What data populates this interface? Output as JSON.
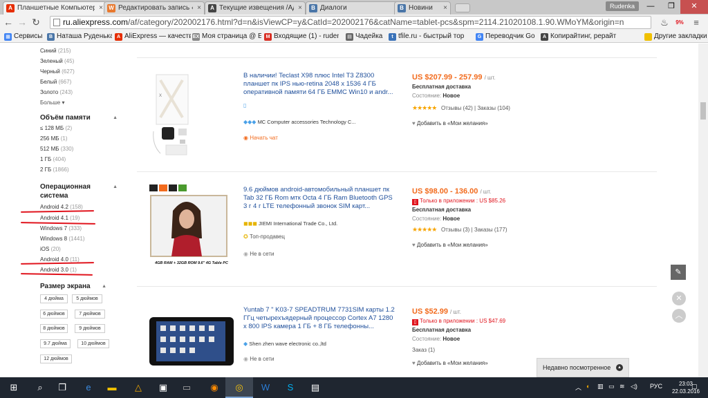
{
  "browser": {
    "tabs": [
      {
        "label": "Планшетные Компьютер",
        "active": true,
        "icon": "aliexpress-icon",
        "color": "#e62e04"
      },
      {
        "label": "Редактировать запись ‹ А",
        "active": false,
        "icon": "wordpress-icon",
        "color": "#e8792f"
      },
      {
        "label": "Текущие извещения /Адм",
        "active": false,
        "icon": "advego-icon",
        "color": "#444444"
      },
      {
        "label": "Диалоги",
        "active": false,
        "icon": "vk-icon",
        "color": "#4a76a8"
      },
      {
        "label": "Новини",
        "active": false,
        "icon": "vk-icon",
        "color": "#4a76a8"
      }
    ],
    "user": "Rudenka",
    "url_host": "ru.aliexpress.com",
    "url_rest": "/af/category/202002176.html?d=n&isViewCP=y&CatId=202002176&catName=tablet-pcs&spm=2114.21020108.1.90.WMoYM&origin=n",
    "ext_badge": "9%"
  },
  "bookmarks": [
    {
      "label": "Сервисы",
      "icon": "apps-icon",
      "color": "#4285f4"
    },
    {
      "label": "Наташа Руденька",
      "icon": "vk-icon",
      "color": "#4a76a8"
    },
    {
      "label": "AliExpress — качеств",
      "icon": "aliexpress-icon",
      "color": "#e62e04"
    },
    {
      "label": "Моя страница @ EXAI",
      "icon": "ex-icon",
      "color": "#888888"
    },
    {
      "label": "Входящие (1) - ruden",
      "icon": "gmail-icon",
      "color": "#d93025"
    },
    {
      "label": "Чадейка",
      "icon": "page-icon",
      "color": "#666666"
    },
    {
      "label": "tfile.ru - быстрый тор",
      "icon": "tfile-icon",
      "color": "#3b73b9"
    },
    {
      "label": "Переводчик Google",
      "icon": "translate-icon",
      "color": "#4285f4"
    },
    {
      "label": "Копирайтинг, рерайт",
      "icon": "advego-icon",
      "color": "#444444"
    },
    {
      "label": "Другие закладки",
      "icon": "folder-icon",
      "color": "#f0c000"
    }
  ],
  "sidebar": {
    "colors": [
      {
        "name": "Синий",
        "count": "(215)"
      },
      {
        "name": "Зеленый",
        "count": "(45)"
      },
      {
        "name": "Черный",
        "count": "(627)"
      },
      {
        "name": "Белый",
        "count": "(667)"
      },
      {
        "name": "Золото",
        "count": "(243)"
      }
    ],
    "more": "Больше ▾",
    "memory_title": "Объём памяти",
    "memory": [
      {
        "name": "≤ 128 МБ",
        "count": "(2)"
      },
      {
        "name": "256 МБ",
        "count": "(1)"
      },
      {
        "name": "512 МБ",
        "count": "(330)"
      },
      {
        "name": "1 ГБ",
        "count": "(404)"
      },
      {
        "name": "2 ГБ",
        "count": "(1866)"
      }
    ],
    "os_title_1": "Операционная",
    "os_title_2": "система",
    "os": [
      {
        "name": "Android 4.2",
        "count": "(158)"
      },
      {
        "name": "Android 4.1",
        "count": "(19)"
      },
      {
        "name": "Windows 7",
        "count": "(333)"
      },
      {
        "name": "Windows 8",
        "count": "(1441)"
      },
      {
        "name": "iOS",
        "count": "(20)"
      },
      {
        "name": "Android 4.0",
        "count": "(11)"
      },
      {
        "name": "Android 3.0",
        "count": "(1)"
      }
    ],
    "screen_title": "Размер экрана",
    "screen_sizes": [
      "4 дюйма",
      "5 дюймов",
      "6 дюймов",
      "7 дюймов",
      "8 дюймов",
      "9 дюймов",
      "9.7 дюйма",
      "10 дюймов",
      "12 дюймов"
    ]
  },
  "products": [
    {
      "title": "В наличии! Teclast X98 плюс Intel T3 Z8300 планшет пк IPS нью-retina 2048 x 1536 4 ГБ оперативной памяти 64 ГБ EMMC Win10 и andr...",
      "store": "MC Computer accessories Technology C...",
      "extra": "Начать чат",
      "price": "US $207.99 - 257.99",
      "unit": "/ шт.",
      "app_price": "",
      "shipping": "Бесплатная доставка",
      "condition_label": "Состояние:",
      "condition": "Новое",
      "reviews": "Отзывы (42)",
      "orders": "Заказы (104)",
      "wishlist": "Добавить в «Мои желания»"
    },
    {
      "title": "9.6 дюймов android-автомобильный планшет пк Tab 32 ГБ Rom мтк Octa 4 ГБ Ram Bluetooth GPS 3 г 4 г LTE телефонный звонок SIM карт...",
      "store": "JIEMI International Trade Co., Ltd.",
      "extra": "Топ-продавец",
      "extra2": "Не в сети",
      "price": "US $98.00 - 136.00",
      "unit": "/ шт.",
      "app_price": "Только в приложении : US $85.26",
      "shipping": "Бесплатная доставка",
      "condition_label": "Состояние:",
      "condition": "Новое",
      "reviews": "Отзывы (3)",
      "orders": "Заказы (177)",
      "wishlist": "Добавить в «Мои желания»",
      "image_caption": "4GB RAM + 32GB ROM 9.6\" 4G Table PC"
    },
    {
      "title": "Yuntab 7 \" K03-7 SPEADTRUM 7731SIM карты 1.2 ГГц четырехъядерный процессор Cortex A7 1280 x 800 IPS камера 1 ГБ + 8 ГБ телефонны...",
      "store": "Shen zhen wave electronic co.,ltd",
      "extra": "Не в сети",
      "price": "US $52.99",
      "unit": "/ шт.",
      "app_price": "Только в приложении : US $47.69",
      "shipping": "Бесплатная доставка",
      "condition_label": "Состояние:",
      "condition": "Новое",
      "orders": "Заказ (1)",
      "wishlist": "Добавить в «Мои желания»"
    }
  ],
  "recently_viewed": "Недавно посмотренное",
  "taskbar": {
    "lang": "РУС",
    "time": "23:03",
    "date": "22.03.2016"
  }
}
